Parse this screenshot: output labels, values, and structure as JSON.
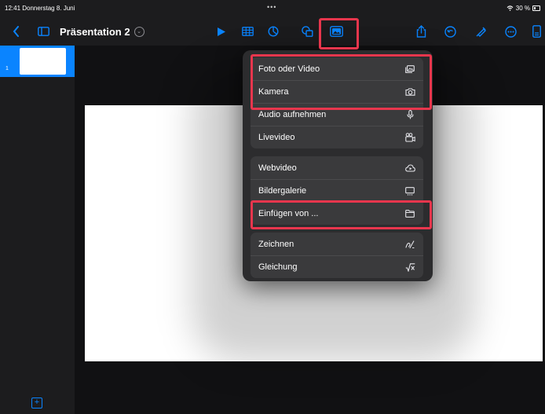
{
  "status": {
    "time_date": "12:41  Donnerstag 8. Juni",
    "dots": "•••",
    "battery_text": "30 %"
  },
  "toolbar": {
    "doc_title": "Präsentation 2"
  },
  "sidebar": {
    "slide_number": "1"
  },
  "menu": {
    "groups": [
      [
        {
          "label": "Foto oder Video",
          "icon": "photo-icon"
        },
        {
          "label": "Kamera",
          "icon": "camera-icon"
        },
        {
          "label": "Audio aufnehmen",
          "icon": "microphone-icon"
        },
        {
          "label": "Livevideo",
          "icon": "live-video-icon"
        }
      ],
      [
        {
          "label": "Webvideo",
          "icon": "web-video-icon"
        },
        {
          "label": "Bildergalerie",
          "icon": "image-gallery-icon"
        },
        {
          "label": "Einfügen von ...",
          "icon": "folder-icon"
        }
      ],
      [
        {
          "label": "Zeichnen",
          "icon": "drawing-icon"
        },
        {
          "label": "Gleichung",
          "icon": "equation-icon"
        }
      ]
    ]
  },
  "colors": {
    "accent": "#0a84ff",
    "highlight": "#e8364d",
    "menu_bg": "#2c2c2e",
    "group_bg": "#3a3a3c"
  }
}
